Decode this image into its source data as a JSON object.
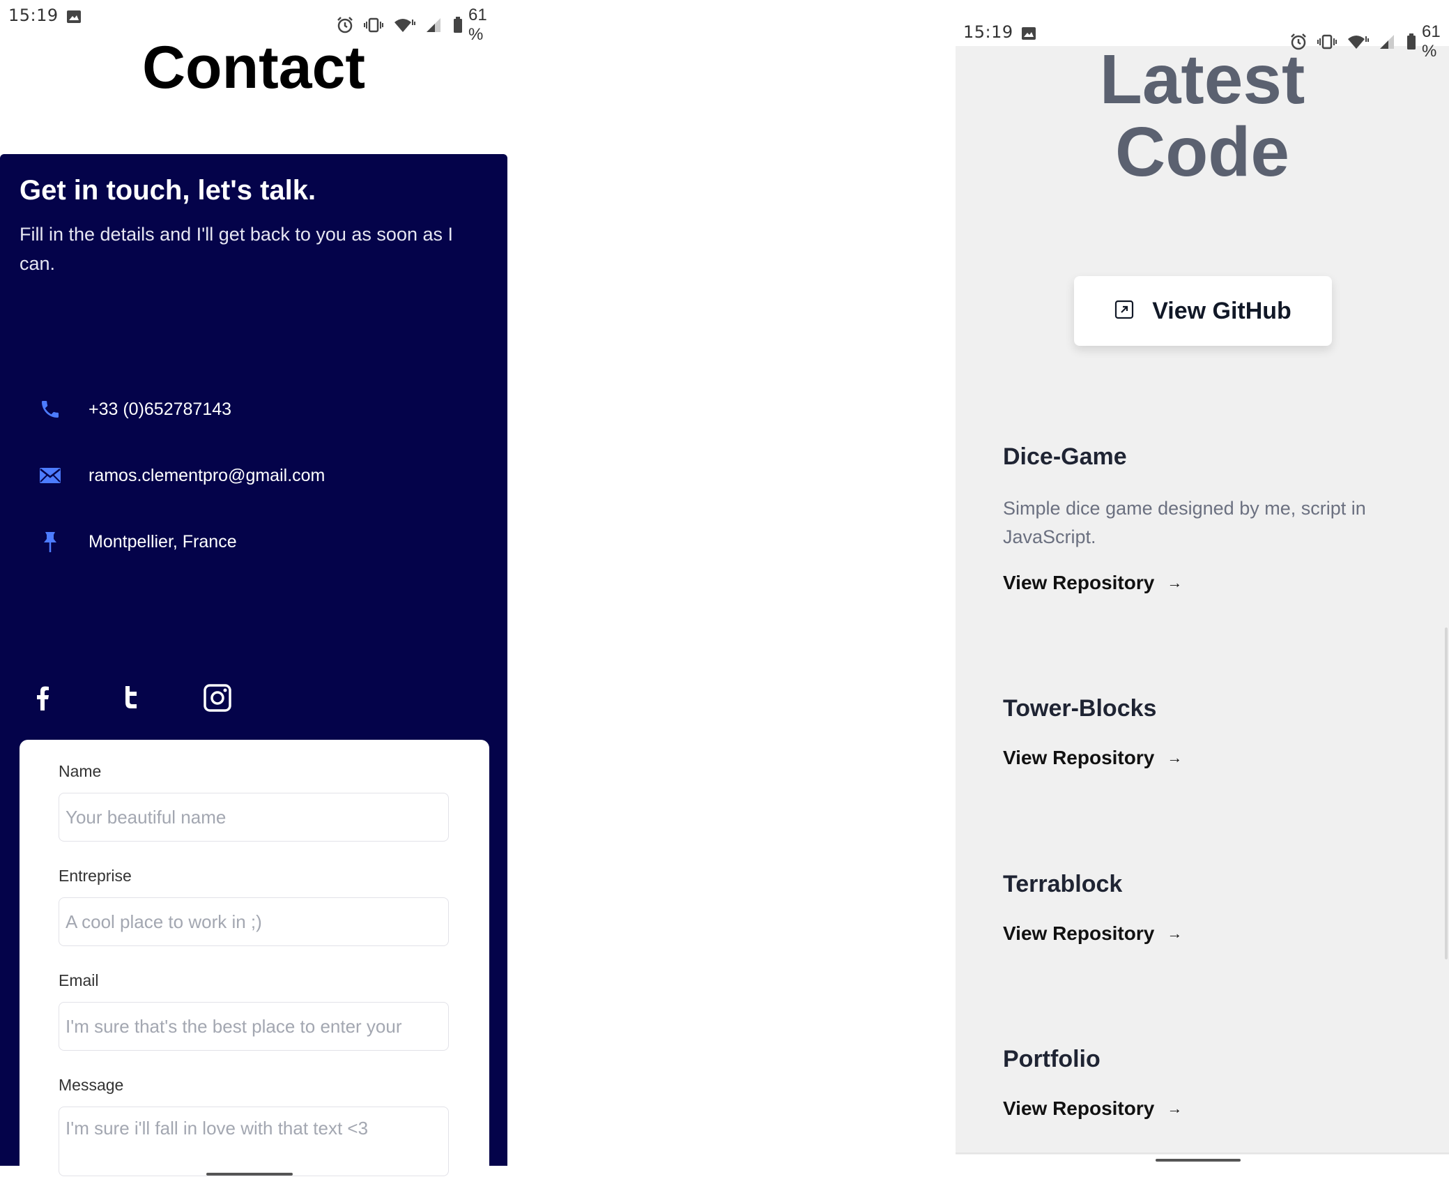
{
  "left": {
    "status": {
      "time": "15:19",
      "battery": "61 %"
    },
    "title": "Contact",
    "panel": {
      "heading": "Get in touch, let's talk.",
      "subtext": "Fill in the details and I'll get back to you as soon as I can.",
      "phone": "+33 (0)652787143",
      "email": "ramos.clementpro@gmail.com",
      "location": "Montpellier, France"
    },
    "social": [
      "facebook-icon",
      "twitter-icon",
      "instagram-icon"
    ],
    "form": {
      "name_label": "Name",
      "name_placeholder": "Your beautiful name",
      "entreprise_label": "Entreprise",
      "entreprise_placeholder": "A cool place to work in ;)",
      "email_label": "Email",
      "email_placeholder": "I'm sure that's the best place to enter your",
      "message_label": "Message",
      "message_placeholder": "I'm sure i'll fall in love with that text <3"
    }
  },
  "right": {
    "status": {
      "time": "15:19",
      "battery": "61 %"
    },
    "title_line1": "Latest",
    "title_line2": "Code",
    "github_button": "View GitHub",
    "projects": [
      {
        "title": "Dice-Game",
        "description": "Simple dice game designed by me, script in JavaScript.",
        "link": "View Repository",
        "arrow": "→"
      },
      {
        "title": "Tower-Blocks",
        "link": "View Repository",
        "arrow": "→"
      },
      {
        "title": "Terrablock",
        "link": "View Repository",
        "arrow": "→"
      },
      {
        "title": "Portfolio",
        "link": "View Repository",
        "arrow": "→"
      }
    ]
  },
  "colors": {
    "panel_bg": "#04034a",
    "accent_icon": "#4d7cff",
    "right_bg": "#f0f0f0",
    "title_gray": "#5b6170"
  }
}
